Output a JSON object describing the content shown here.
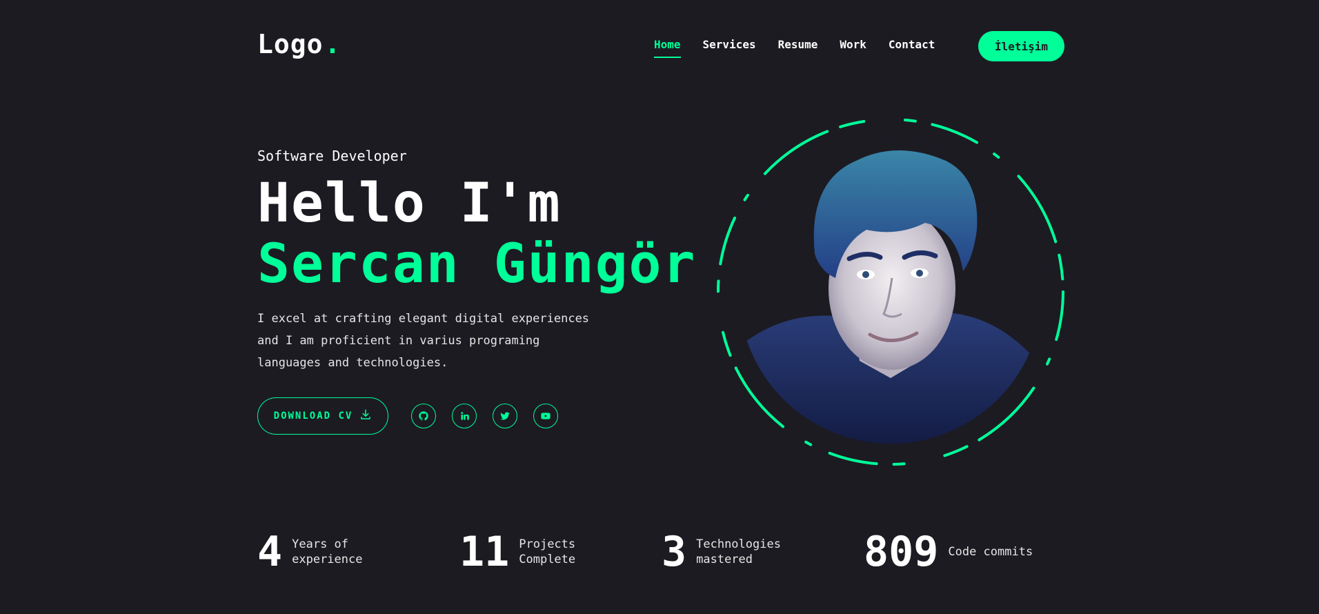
{
  "header": {
    "logo_text": "Logo",
    "logo_dot": ".",
    "nav": [
      {
        "label": "Home",
        "active": true
      },
      {
        "label": "Services",
        "active": false
      },
      {
        "label": "Resume",
        "active": false
      },
      {
        "label": "Work",
        "active": false
      },
      {
        "label": "Contact",
        "active": false
      }
    ],
    "cta_label": "İletişim"
  },
  "hero": {
    "subtitle": "Software Developer",
    "greeting": "Hello I'm",
    "name": "Sercan Güngör",
    "description": "I excel at crafting elegant digital experiences and I am proficient in varius programing languages and technologies.",
    "download_label": "DOWNLOAD CV",
    "socials": [
      {
        "icon": "github-icon"
      },
      {
        "icon": "linkedin-icon"
      },
      {
        "icon": "twitter-icon"
      },
      {
        "icon": "youtube-icon"
      }
    ]
  },
  "stats": [
    {
      "value": "4",
      "label": "Years of experience"
    },
    {
      "value": "11",
      "label": "Projects Complete"
    },
    {
      "value": "3",
      "label": "Technologies mastered"
    },
    {
      "value": "809",
      "label": "Code commits"
    }
  ],
  "colors": {
    "accent": "#00ff99",
    "background": "#1c1b22",
    "text": "#ffffff"
  }
}
